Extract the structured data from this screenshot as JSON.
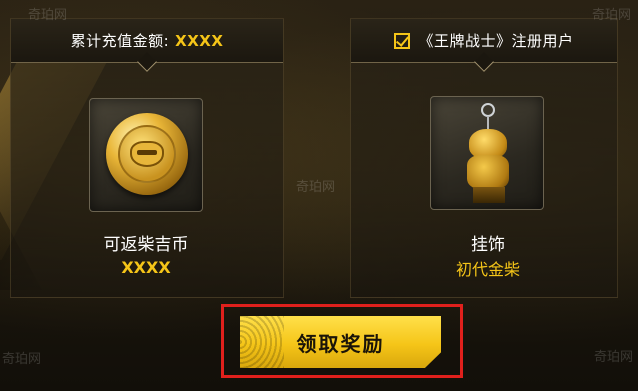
{
  "left_panel": {
    "header_label": "累计充值金额:",
    "header_value": "XXXX",
    "item_name": "可返柴吉币",
    "item_value": "XXXX",
    "item_icon": "gold-coin-icon"
  },
  "right_panel": {
    "header_label": "《王牌战士》注册用户",
    "checked": true,
    "item_name": "挂饰",
    "item_value": "初代金柴",
    "item_icon": "gold-dog-pendant-icon"
  },
  "claim_button": {
    "label": "领取奖励"
  },
  "watermark": "奇珀网",
  "colors": {
    "accent": "#f5c518",
    "highlight": "#e0201c"
  }
}
